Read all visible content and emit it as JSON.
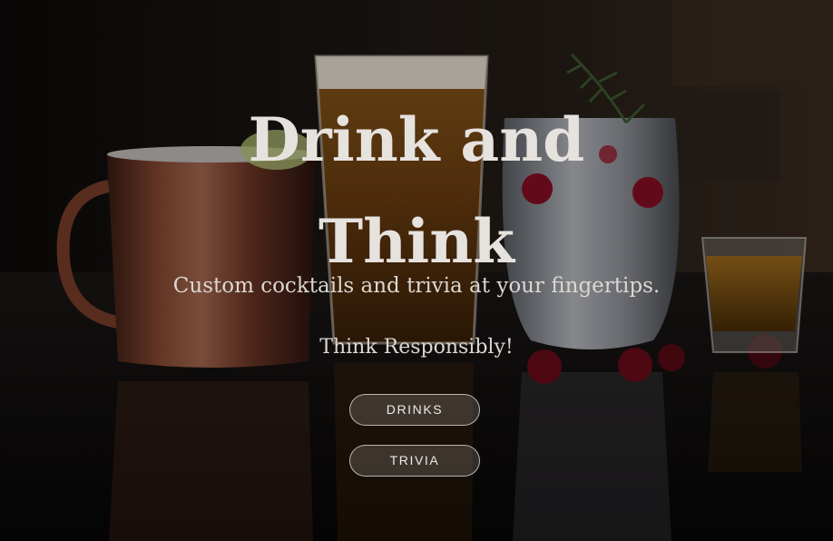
{
  "hero": {
    "title_line1": "Drink and",
    "title_line2": "Think",
    "subtitle": "Custom cocktails and trivia at your fingertips.",
    "tagline": "Think Responsibly!"
  },
  "buttons": {
    "drinks_label": "DRINKS",
    "trivia_label": "TRIVIA"
  },
  "background": {
    "subject": "drinks on a bar counter",
    "items": [
      "copper-mug-icon",
      "beer-glass-icon",
      "cocktail-glass-icon",
      "shot-glass-icon",
      "cranberry-icon",
      "rosemary-icon"
    ]
  },
  "colors": {
    "text": "#e6e2de",
    "button_border": "#e6e1dc",
    "background": "#0b0908"
  }
}
